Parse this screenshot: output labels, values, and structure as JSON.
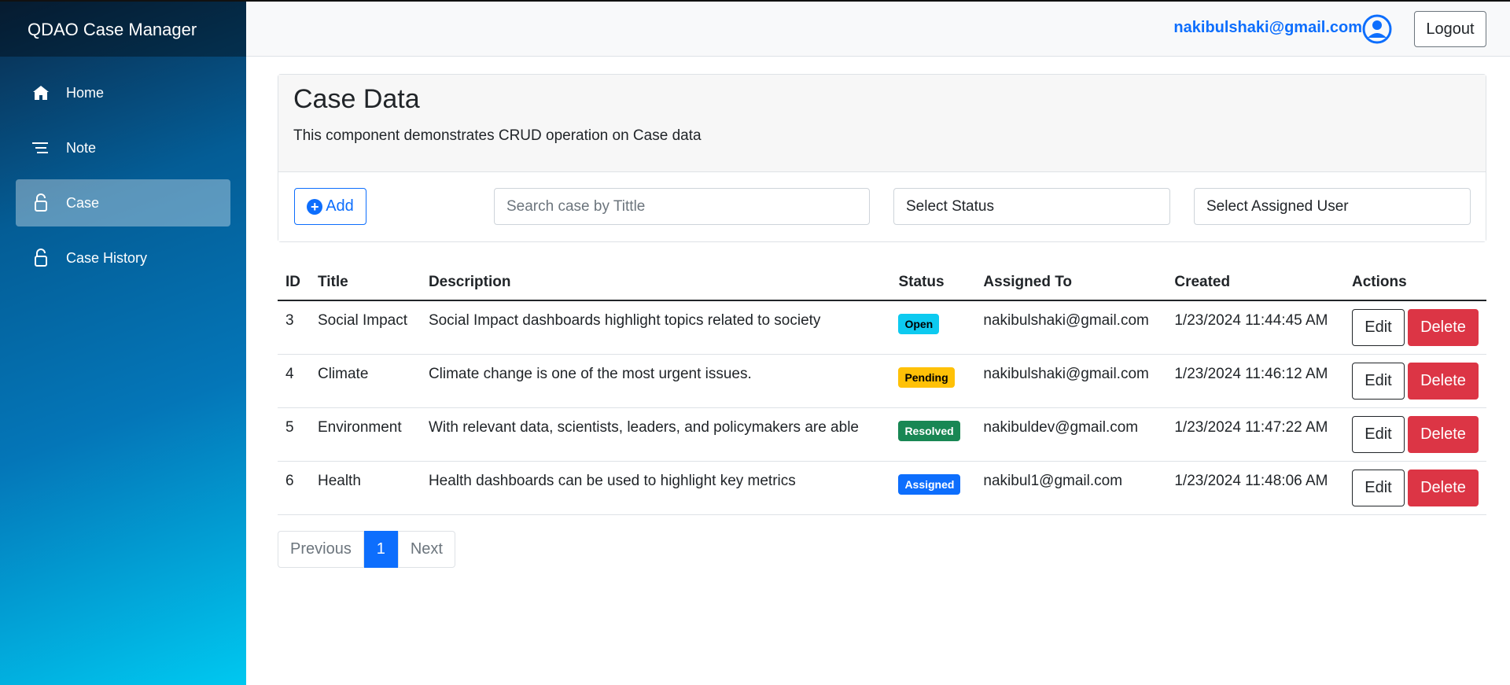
{
  "app": {
    "brand": "QDAO Case Manager"
  },
  "sidebar": {
    "items": [
      {
        "label": "Home",
        "icon": "home-icon"
      },
      {
        "label": "Note",
        "icon": "lines-icon"
      },
      {
        "label": "Case",
        "icon": "lock-icon",
        "active": true
      },
      {
        "label": "Case History",
        "icon": "lock-icon"
      }
    ]
  },
  "topbar": {
    "user_email": "nakibulshaki@gmail.com",
    "logout_label": "Logout"
  },
  "card": {
    "title": "Case Data",
    "subtitle": "This component demonstrates CRUD operation on Case data"
  },
  "toolbar": {
    "add_label": "Add",
    "search_placeholder": "Search case by Tittle",
    "status_select": "Select Status",
    "user_select": "Select Assigned User"
  },
  "table": {
    "headers": [
      "ID",
      "Title",
      "Description",
      "Status",
      "Assigned To",
      "Created",
      "Actions"
    ],
    "rows": [
      {
        "id": "3",
        "title": "Social Impact",
        "description": "Social Impact dashboards highlight topics related to society",
        "status": "Open",
        "assigned_to": "nakibulshaki@gmail.com",
        "created": "1/23/2024 11:44:45 AM"
      },
      {
        "id": "4",
        "title": "Climate",
        "description": "Climate change is one of the most urgent issues.",
        "status": "Pending",
        "assigned_to": "nakibulshaki@gmail.com",
        "created": "1/23/2024 11:46:12 AM"
      },
      {
        "id": "5",
        "title": "Environment",
        "description": "With relevant data, scientists, leaders, and policymakers are able",
        "status": "Resolved",
        "assigned_to": "nakibuldev@gmail.com",
        "created": "1/23/2024 11:47:22 AM"
      },
      {
        "id": "6",
        "title": "Health",
        "description": "Health dashboards can be used to highlight key metrics",
        "status": "Assigned",
        "assigned_to": "nakibul1@gmail.com",
        "created": "1/23/2024 11:48:06 AM"
      }
    ],
    "edit_label": "Edit",
    "delete_label": "Delete"
  },
  "pagination": {
    "previous": "Previous",
    "current": "1",
    "next": "Next"
  },
  "colors": {
    "primary": "#0d6efd",
    "danger": "#dc3545",
    "open": "#0dcaf0",
    "pending": "#ffc107",
    "resolved": "#198754",
    "assigned": "#0d6efd"
  }
}
